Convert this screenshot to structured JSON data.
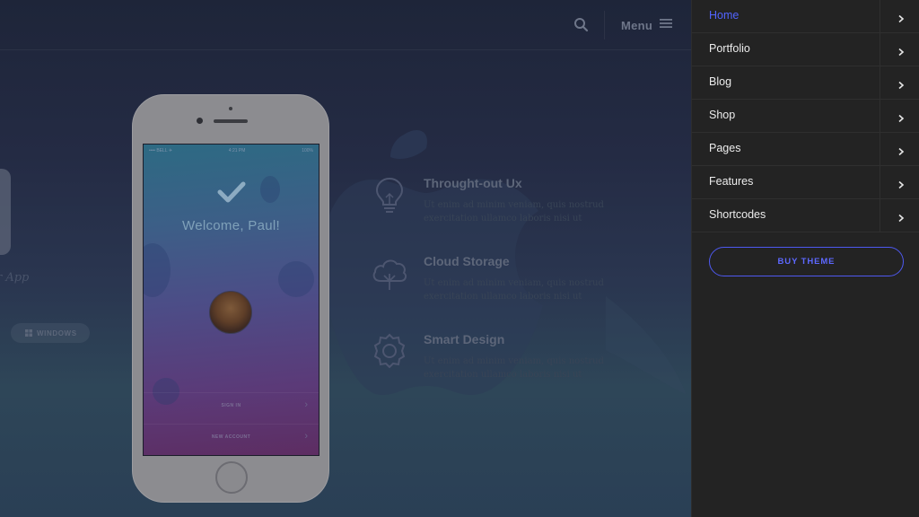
{
  "header": {
    "search_icon": "search-icon",
    "menu_label": "Menu",
    "menu_icon": "hamburger-icon"
  },
  "left_fragment": {
    "app_text": "r App",
    "windows_label": "WINDOWS"
  },
  "phone": {
    "status": {
      "carrier": "•••• BELL ✈",
      "time": "4:21 PM",
      "battery": "100%"
    },
    "welcome": "Welcome, Paul!",
    "sign_in": "SIGN IN",
    "new_account": "NEW ACCOUNT"
  },
  "features": [
    {
      "title": "Throught-out Ux",
      "text": "Ut enim ad minim veniam, quis nostrud exercitation ullamco laboris nisi ut",
      "icon": "lightbulb-icon"
    },
    {
      "title": "Cloud Storage",
      "text": "Ut enim ad minim veniam, quis nostrud exercitation ullamco laboris nisi ut",
      "icon": "cloud-tree-icon"
    },
    {
      "title": "Smart Design",
      "text": "Ut enim ad minim veniam, quis nostrud exercitation ullamco laboris nisi ut",
      "icon": "award-badge-icon"
    }
  ],
  "side_menu": {
    "items": [
      {
        "label": "Home",
        "active": true
      },
      {
        "label": "Portfolio",
        "active": false
      },
      {
        "label": "Blog",
        "active": false
      },
      {
        "label": "Shop",
        "active": false
      },
      {
        "label": "Pages",
        "active": false
      },
      {
        "label": "Features",
        "active": false
      },
      {
        "label": "Shortcodes",
        "active": false
      }
    ],
    "buy_label": "BUY THEME"
  },
  "colors": {
    "accent": "#5264ff",
    "menu_bg": "#232323",
    "page_bg": "#242b44"
  }
}
